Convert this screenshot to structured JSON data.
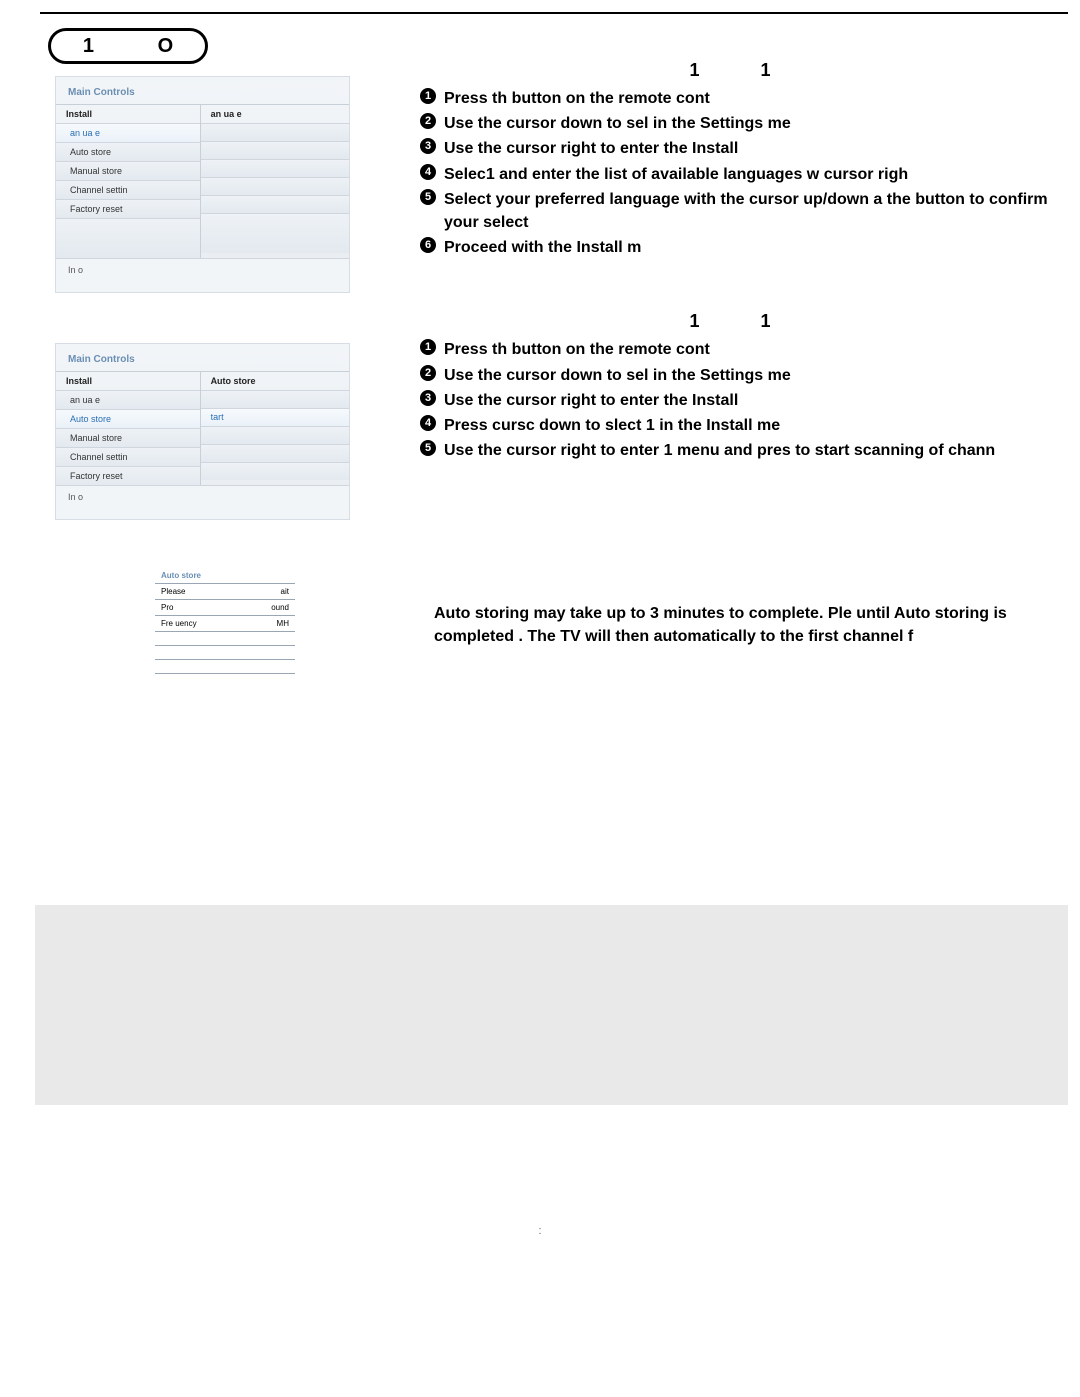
{
  "badge": {
    "left": "1",
    "right": "O"
  },
  "panel1": {
    "header": "Main Controls",
    "row_l": "Install",
    "row_r": "an   ua   e",
    "items": [
      "an   ua   e",
      "Auto store",
      "Manual store",
      "Channel settin",
      "Factory reset"
    ],
    "hl_index": 0,
    "info": "In   o"
  },
  "panel2": {
    "header": "Main Controls",
    "row_l": "Install",
    "row_r": "Auto store",
    "items": [
      "an   ua   e",
      "Auto store",
      "Manual store",
      "Channel settin",
      "Factory reset"
    ],
    "hl_index": 1,
    "right_items": [
      "",
      "tart",
      "",
      "",
      ""
    ],
    "right_hl_index": 1,
    "info": "In   o"
  },
  "mini": {
    "header": "Auto store",
    "rows": [
      {
        "l": "Please",
        "r": "ait"
      },
      {
        "l": "Pro",
        "r": "ound"
      },
      {
        "l": "Fre   uency",
        "r": "MH"
      }
    ]
  },
  "section1": {
    "title": "1    1",
    "steps": [
      "Press th            button on the remote cont",
      "Use the cursor down to sel          in the Settings me",
      "Use the cursor right to enter the Install ",
      "Selec1              and enter the list of available languages w     cursor righ",
      "Select your preferred language with the cursor up/down a          the       button to confirm your select",
      "Proceed with the Install m"
    ]
  },
  "section2": {
    "title": "1    1",
    "steps": [
      "Press th            button on the remote cont",
      "Use the cursor down to sel          in the Settings me",
      "Use the cursor right to enter the Install ",
      "Press cursc down to slect               1   in the Install me",
      "Use the cursor right to enter              1   menu and pres             to start scanning of chann"
    ]
  },
  "note": "Auto storing may take up to 3 minutes to complete.  Ple         until Auto storing is completed .  The TV will then automatically to the first channel f",
  "page_no": ":"
}
